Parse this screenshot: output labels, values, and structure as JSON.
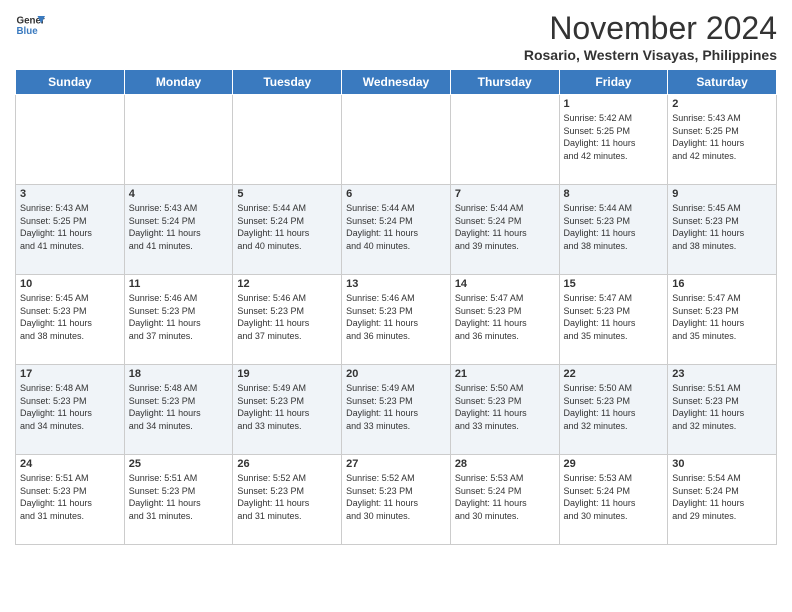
{
  "logo": {
    "line1": "General",
    "line2": "Blue"
  },
  "title": "November 2024",
  "location": "Rosario, Western Visayas, Philippines",
  "days_of_week": [
    "Sunday",
    "Monday",
    "Tuesday",
    "Wednesday",
    "Thursday",
    "Friday",
    "Saturday"
  ],
  "weeks": [
    [
      {
        "day": null,
        "info": null
      },
      {
        "day": null,
        "info": null
      },
      {
        "day": null,
        "info": null
      },
      {
        "day": null,
        "info": null
      },
      {
        "day": null,
        "info": null
      },
      {
        "day": "1",
        "info": "Sunrise: 5:42 AM\nSunset: 5:25 PM\nDaylight: 11 hours\nand 42 minutes."
      },
      {
        "day": "2",
        "info": "Sunrise: 5:43 AM\nSunset: 5:25 PM\nDaylight: 11 hours\nand 42 minutes."
      }
    ],
    [
      {
        "day": "3",
        "info": "Sunrise: 5:43 AM\nSunset: 5:25 PM\nDaylight: 11 hours\nand 41 minutes."
      },
      {
        "day": "4",
        "info": "Sunrise: 5:43 AM\nSunset: 5:24 PM\nDaylight: 11 hours\nand 41 minutes."
      },
      {
        "day": "5",
        "info": "Sunrise: 5:44 AM\nSunset: 5:24 PM\nDaylight: 11 hours\nand 40 minutes."
      },
      {
        "day": "6",
        "info": "Sunrise: 5:44 AM\nSunset: 5:24 PM\nDaylight: 11 hours\nand 40 minutes."
      },
      {
        "day": "7",
        "info": "Sunrise: 5:44 AM\nSunset: 5:24 PM\nDaylight: 11 hours\nand 39 minutes."
      },
      {
        "day": "8",
        "info": "Sunrise: 5:44 AM\nSunset: 5:23 PM\nDaylight: 11 hours\nand 38 minutes."
      },
      {
        "day": "9",
        "info": "Sunrise: 5:45 AM\nSunset: 5:23 PM\nDaylight: 11 hours\nand 38 minutes."
      }
    ],
    [
      {
        "day": "10",
        "info": "Sunrise: 5:45 AM\nSunset: 5:23 PM\nDaylight: 11 hours\nand 38 minutes."
      },
      {
        "day": "11",
        "info": "Sunrise: 5:46 AM\nSunset: 5:23 PM\nDaylight: 11 hours\nand 37 minutes."
      },
      {
        "day": "12",
        "info": "Sunrise: 5:46 AM\nSunset: 5:23 PM\nDaylight: 11 hours\nand 37 minutes."
      },
      {
        "day": "13",
        "info": "Sunrise: 5:46 AM\nSunset: 5:23 PM\nDaylight: 11 hours\nand 36 minutes."
      },
      {
        "day": "14",
        "info": "Sunrise: 5:47 AM\nSunset: 5:23 PM\nDaylight: 11 hours\nand 36 minutes."
      },
      {
        "day": "15",
        "info": "Sunrise: 5:47 AM\nSunset: 5:23 PM\nDaylight: 11 hours\nand 35 minutes."
      },
      {
        "day": "16",
        "info": "Sunrise: 5:47 AM\nSunset: 5:23 PM\nDaylight: 11 hours\nand 35 minutes."
      }
    ],
    [
      {
        "day": "17",
        "info": "Sunrise: 5:48 AM\nSunset: 5:23 PM\nDaylight: 11 hours\nand 34 minutes."
      },
      {
        "day": "18",
        "info": "Sunrise: 5:48 AM\nSunset: 5:23 PM\nDaylight: 11 hours\nand 34 minutes."
      },
      {
        "day": "19",
        "info": "Sunrise: 5:49 AM\nSunset: 5:23 PM\nDaylight: 11 hours\nand 33 minutes."
      },
      {
        "day": "20",
        "info": "Sunrise: 5:49 AM\nSunset: 5:23 PM\nDaylight: 11 hours\nand 33 minutes."
      },
      {
        "day": "21",
        "info": "Sunrise: 5:50 AM\nSunset: 5:23 PM\nDaylight: 11 hours\nand 33 minutes."
      },
      {
        "day": "22",
        "info": "Sunrise: 5:50 AM\nSunset: 5:23 PM\nDaylight: 11 hours\nand 32 minutes."
      },
      {
        "day": "23",
        "info": "Sunrise: 5:51 AM\nSunset: 5:23 PM\nDaylight: 11 hours\nand 32 minutes."
      }
    ],
    [
      {
        "day": "24",
        "info": "Sunrise: 5:51 AM\nSunset: 5:23 PM\nDaylight: 11 hours\nand 31 minutes."
      },
      {
        "day": "25",
        "info": "Sunrise: 5:51 AM\nSunset: 5:23 PM\nDaylight: 11 hours\nand 31 minutes."
      },
      {
        "day": "26",
        "info": "Sunrise: 5:52 AM\nSunset: 5:23 PM\nDaylight: 11 hours\nand 31 minutes."
      },
      {
        "day": "27",
        "info": "Sunrise: 5:52 AM\nSunset: 5:23 PM\nDaylight: 11 hours\nand 30 minutes."
      },
      {
        "day": "28",
        "info": "Sunrise: 5:53 AM\nSunset: 5:24 PM\nDaylight: 11 hours\nand 30 minutes."
      },
      {
        "day": "29",
        "info": "Sunrise: 5:53 AM\nSunset: 5:24 PM\nDaylight: 11 hours\nand 30 minutes."
      },
      {
        "day": "30",
        "info": "Sunrise: 5:54 AM\nSunset: 5:24 PM\nDaylight: 11 hours\nand 29 minutes."
      }
    ]
  ]
}
